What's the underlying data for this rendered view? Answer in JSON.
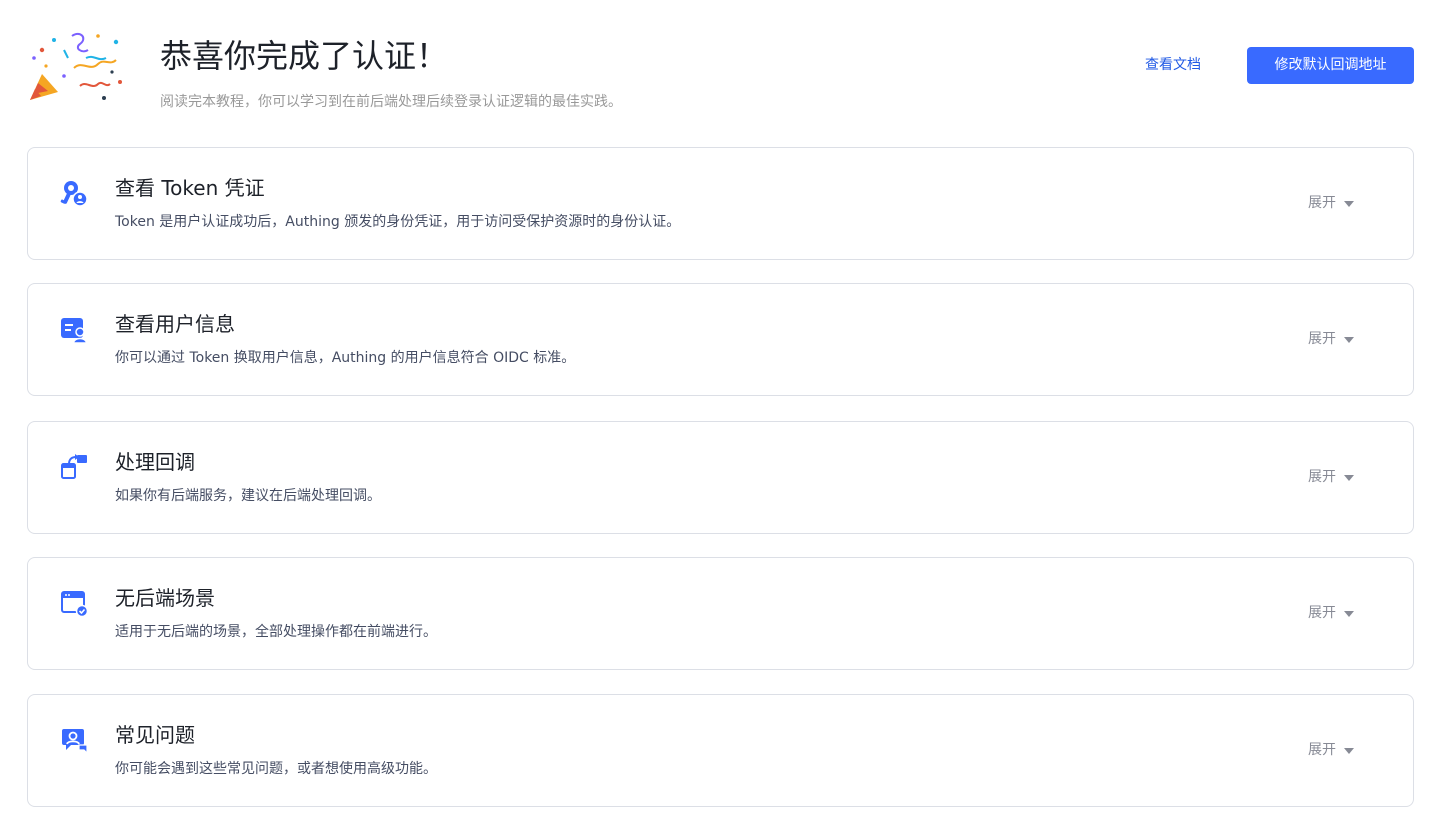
{
  "header": {
    "title": "恭喜你完成了认证！",
    "subtitle": "阅读完本教程，你可以学习到在前后端处理后续登录认证逻辑的最佳实践。",
    "docs_link": "查看文档",
    "primary_button": "修改默认回调地址"
  },
  "colors": {
    "accent": "#396aff",
    "link": "#215ae5",
    "card_border": "#dcdfe6"
  },
  "sections": [
    {
      "title": "查看 Token 凭证",
      "description": "Token 是用户认证成功后，Authing 颁发的身份凭证，用于访问受保护资源时的身份认证。",
      "icon": "key-user-icon",
      "expand_label": "展开"
    },
    {
      "title": "查看用户信息",
      "description": "你可以通过 Token 换取用户信息，Authing 的用户信息符合 OIDC 标准。",
      "icon": "user-card-icon",
      "expand_label": "展开"
    },
    {
      "title": "处理回调",
      "description": "如果你有后端服务，建议在后端处理回调。",
      "icon": "callback-icon",
      "expand_label": "展开"
    },
    {
      "title": "无后端场景",
      "description": "适用于无后端的场景，全部处理操作都在前端进行。",
      "icon": "browser-check-icon",
      "expand_label": "展开"
    },
    {
      "title": "常见问题",
      "description": "你可能会遇到这些常见问题，或者想使用高级功能。",
      "icon": "faq-chat-icon",
      "expand_label": "展开"
    }
  ]
}
